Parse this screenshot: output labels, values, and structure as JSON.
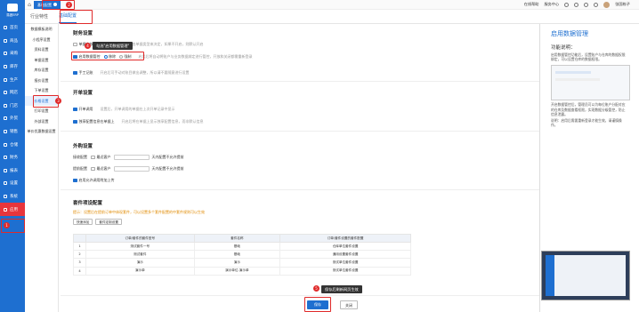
{
  "app_name": "易团ERP",
  "nav": [
    "首页",
    "商品",
    "采购",
    "库存",
    "生产",
    "网店",
    "门店",
    "外贸",
    "销售",
    "仓储",
    "财务",
    "报表",
    "设置",
    "系统",
    "应用"
  ],
  "subnav": [
    "数据模板说明",
    "小程序设置",
    "资料设置",
    "单据设置",
    "库存设置",
    "报价设置",
    "下单设置",
    "价格设置",
    "打印设置",
    "外部设置",
    "单价优惠数据设置"
  ],
  "topbar": {
    "tab_label": "基础配置",
    "badge2": "2",
    "right_items": [
      "在线帮助",
      "服务中心"
    ],
    "user": "张国栋子"
  },
  "tabs": [
    "行业特性",
    "基础配置"
  ],
  "sections": {
    "finance": "财务设置",
    "open_order": "开单设置",
    "check": "外购设置",
    "warehouse": "套件项设配置"
  },
  "rows": {
    "r1": "单据审核模式",
    "r1_hint": "开启后审核权限由单据类型来决定，如果不开启，则默认开启",
    "r2": "启用数据管控",
    "r2_opt1": "移除",
    "r2_opt2": "强制",
    "r2_hint": "启用后将自动将账户与业务数据绑定进行管控，开放和关闭都需重新登录",
    "r3": "手工记账",
    "r3_hint": "开启后可手动对账目做出调整，所以请不要随意进行设置",
    "o1": "开单调用",
    "o1_hint": "设置后，开单调用的单据在上次开单记录中显示",
    "o2": "独享配置信息在单据上",
    "o2_hint": "开启后将在单据上显示独享配置信息，而非默认信息",
    "w1": "接收配置",
    "w1_sel": "最近客户",
    "w1_hint": "天内配置不允许提前",
    "w2": "提前配置",
    "w2_sel": "最近客户",
    "w2_hint": "天内配置不允许提前",
    "w3": "启用允许调用附加上传"
  },
  "tooltip1": "勾选\"启用数据管理\"",
  "tooltip2": "保存后刷新网页生效",
  "warehouse_hint": "提示：设置后在提前订单中体现套件，可以设置多个套件配置的中套件规则可以生效",
  "warehouse_buttons": [
    "快速添加",
    "套件定制设置"
  ],
  "table": {
    "headers": [
      "",
      "订单/套件的套件型号",
      "套件名称",
      "订单/套件设置的套件配置"
    ],
    "rows": [
      [
        "1",
        "测试套件一号",
        "基础",
        "仓库单位套件设置"
      ],
      [
        "2",
        "测试套件",
        "基础",
        "通用设置套件设置"
      ],
      [
        "3",
        "演示",
        "演示",
        "测试单位套件设置"
      ],
      [
        "4",
        "演示单",
        "演示单位-演示单",
        "测试单位套件设置"
      ]
    ]
  },
  "bottom": {
    "save": "保存",
    "close": "关闭"
  },
  "right_panel": {
    "title": "启用数据管理",
    "func": "功能说明：",
    "desc1": "启用数据管控功能后，设置账户与仓库的数据权限绑定，可以设置仓库的数据权限。",
    "desc2": "开启数据管控后，管理员可以为每位账户分配对应的仓库及数据查看权限，实现数据分级管控，防止信息泄露。",
    "desc3": "说明：启用后需要重新登录才能生效，请谨慎操作。"
  },
  "badges": {
    "b1": "1",
    "b2": "2",
    "b3": "3",
    "b4": "4",
    "b5": "5"
  }
}
